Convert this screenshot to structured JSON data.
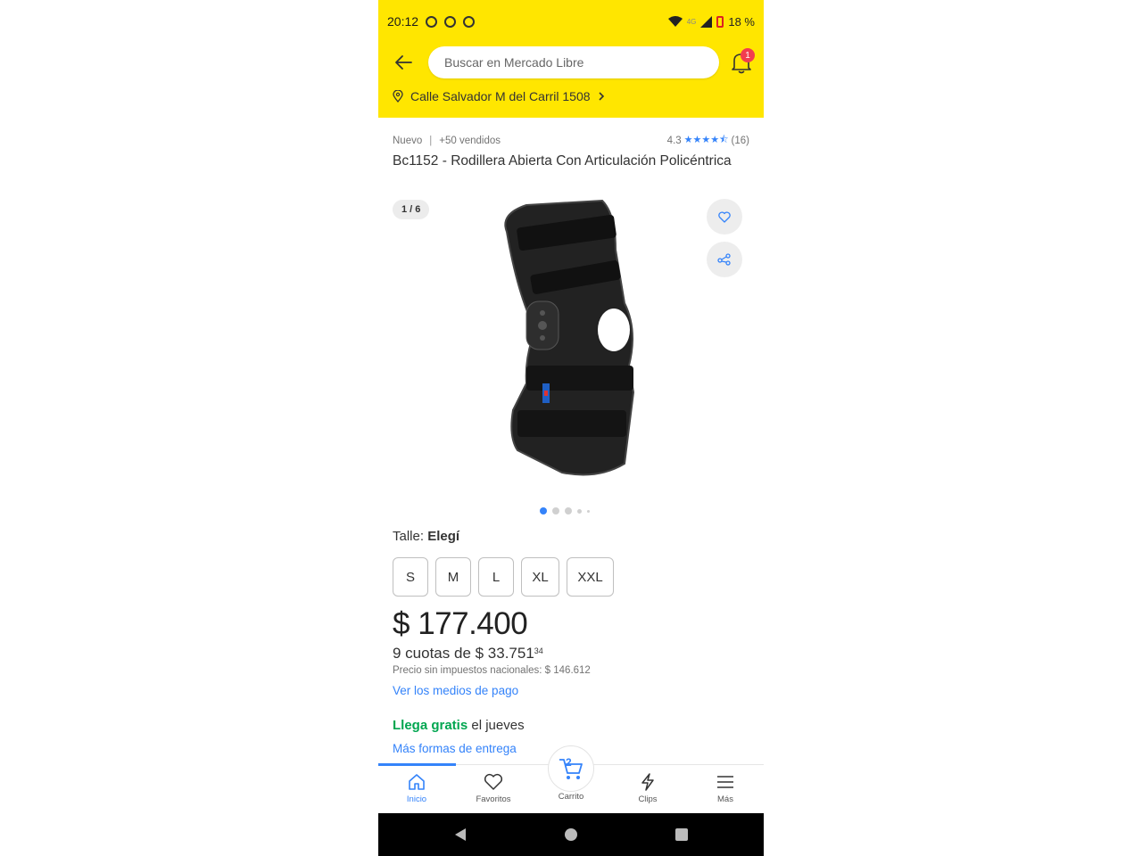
{
  "status_bar": {
    "time": "20:12",
    "network": "4G",
    "battery": "18 %"
  },
  "header": {
    "search_placeholder": "Buscar en Mercado Libre",
    "notifications_count": "1",
    "address": "Calle Salvador M del Carril 1508"
  },
  "product": {
    "condition": "Nuevo",
    "sold": "+50 vendidos",
    "rating_value": "4.3",
    "rating_count": "(16)",
    "title": "Bc1152 - Rodillera Abierta Con Articulación Policéntrica",
    "gallery_counter": "1 / 6"
  },
  "size": {
    "label": "Talle:",
    "selected": "Elegí",
    "options": [
      "S",
      "M",
      "L",
      "XL",
      "XXL"
    ]
  },
  "price": {
    "main": "$ 177.400",
    "installments": "9 cuotas de $ 33.751",
    "installments_cents": "34",
    "without_taxes": "Precio sin impuestos nacionales: $ 146.612",
    "payment_link": "Ver los medios de pago"
  },
  "shipping": {
    "free_label": "Llega gratis",
    "when": " el jueves",
    "more_link": "Más formas de entrega"
  },
  "bottom_nav": {
    "items": [
      {
        "label": "Inicio",
        "icon": "home-icon"
      },
      {
        "label": "Favoritos",
        "icon": "heart-icon"
      },
      {
        "label": "Carrito",
        "icon": "cart-icon"
      },
      {
        "label": "Clips",
        "icon": "bolt-icon"
      },
      {
        "label": "Más",
        "icon": "menu-icon"
      }
    ],
    "cart_count": "2"
  },
  "colors": {
    "brand_yellow": "#ffe600",
    "accent_blue": "#3483fa",
    "green": "#00a650",
    "badge_red": "#f23d4f"
  }
}
